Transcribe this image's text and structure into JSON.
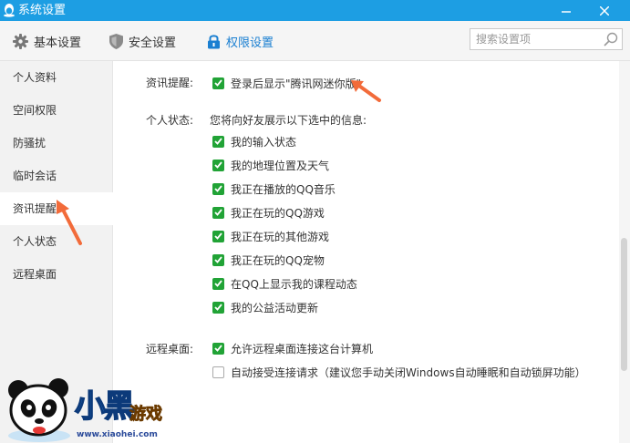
{
  "window": {
    "title": "系统设置"
  },
  "toolbar": {
    "tabs": [
      {
        "label": "基本设置",
        "icon": "gear-icon"
      },
      {
        "label": "安全设置",
        "icon": "shield-icon"
      },
      {
        "label": "权限设置",
        "icon": "lock-icon"
      }
    ],
    "active_tab": "权限设置",
    "search_placeholder": "搜索设置项"
  },
  "sidebar": {
    "items": [
      {
        "label": "个人资料"
      },
      {
        "label": "空间权限"
      },
      {
        "label": "防骚扰"
      },
      {
        "label": "临时会话"
      },
      {
        "label": "资讯提醒"
      },
      {
        "label": "个人状态"
      },
      {
        "label": "远程桌面"
      }
    ],
    "active_item": "资讯提醒"
  },
  "content": {
    "news": {
      "label": "资讯提醒:",
      "option": {
        "label": "登录后显示\"腾讯网迷你版\"",
        "checked": true
      }
    },
    "status": {
      "label": "个人状态:",
      "description": "您将向好友展示以下选中的信息:",
      "options": [
        {
          "label": "我的输入状态",
          "checked": true
        },
        {
          "label": "我的地理位置及天气",
          "checked": true
        },
        {
          "label": "我正在播放的QQ音乐",
          "checked": true
        },
        {
          "label": "我正在玩的QQ游戏",
          "checked": true
        },
        {
          "label": "我正在玩的其他游戏",
          "checked": true
        },
        {
          "label": "我正在玩的QQ宠物",
          "checked": true
        },
        {
          "label": "在QQ上显示我的课程动态",
          "checked": true
        },
        {
          "label": "我的公益活动更新",
          "checked": true
        }
      ]
    },
    "remote": {
      "label": "远程桌面:",
      "options": [
        {
          "label": "允许远程桌面连接这台计算机",
          "checked": true
        },
        {
          "label": "自动接受连接请求（建议您手动关闭Windows自动睡眠和自动锁屏功能）",
          "checked": false
        }
      ]
    }
  },
  "watermark": {
    "title": "小黑",
    "subtitle": "游戏",
    "url": "www.xiaohei.com"
  },
  "colors": {
    "titlebar": "#1d9ee3",
    "accent": "#1a7fd1",
    "checkbox": "#21a336",
    "arrow": "#f26b3a"
  }
}
